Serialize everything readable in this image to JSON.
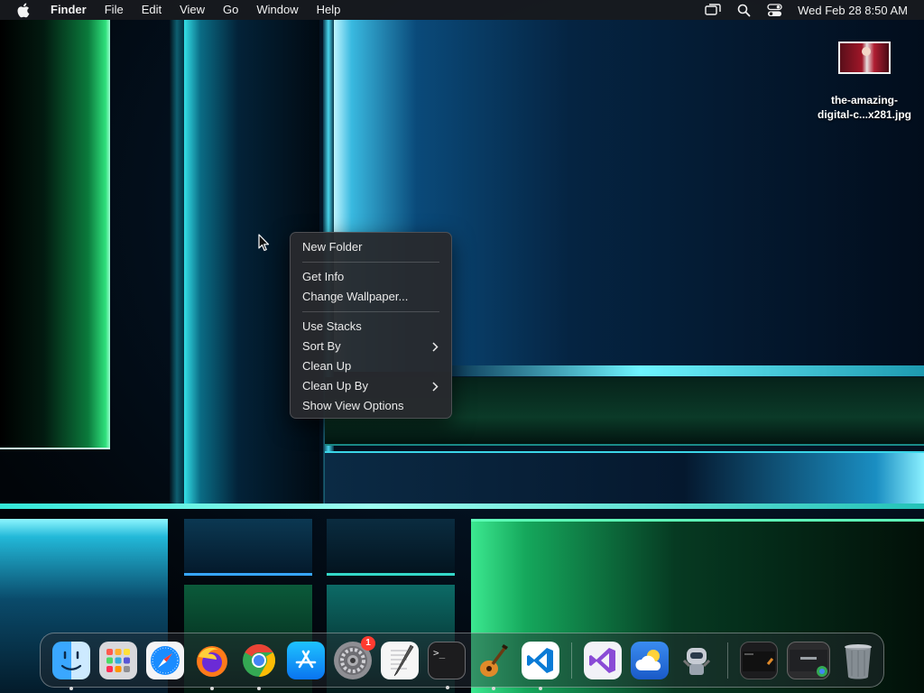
{
  "menubar": {
    "app_name": "Finder",
    "menus": [
      "File",
      "Edit",
      "View",
      "Go",
      "Window",
      "Help"
    ],
    "clock": "Wed Feb 28  8:50 AM",
    "status_icons": [
      "screen-mirroring-icon",
      "spotlight-search-icon",
      "control-center-icon"
    ]
  },
  "desktop": {
    "file": {
      "label_line1": "the-amazing-",
      "label_line2": "digital-c...x281.jpg"
    }
  },
  "context_menu": {
    "items": [
      {
        "label": "New Folder"
      },
      {
        "label": "Get Info"
      },
      {
        "label": "Change Wallpaper..."
      },
      {
        "label": "Use Stacks"
      },
      {
        "label": "Sort By",
        "submenu": true
      },
      {
        "label": "Clean Up"
      },
      {
        "label": "Clean Up By",
        "submenu": true
      },
      {
        "label": "Show View Options"
      }
    ]
  },
  "dock": {
    "settings_badge": "1",
    "terminal_prompt": ">_",
    "apps": [
      "finder",
      "launchpad",
      "safari",
      "firefox",
      "chrome",
      "app-store",
      "system-settings",
      "textedit",
      "terminal",
      "garageband",
      "vscode",
      "visual-studio",
      "weather",
      "automator",
      "window-thumbnail",
      "chrome-window-thumbnail",
      "trash"
    ]
  },
  "colors": {
    "badge": "#ff3b30",
    "menu_bg": "#282a2e",
    "accent_cyan": "#39d6ee",
    "accent_green": "#2fe07c"
  }
}
